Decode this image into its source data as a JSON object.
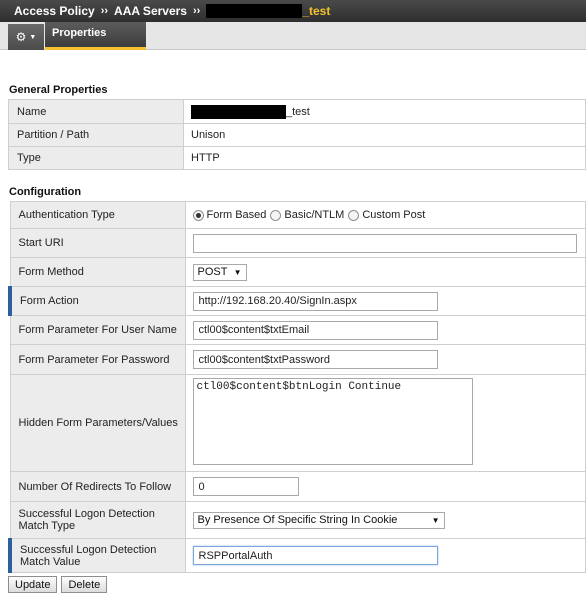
{
  "breadcrumb": {
    "items": [
      "Access Policy",
      "AAA Servers"
    ],
    "separator": "››",
    "last_suffix": "_test"
  },
  "toolbar": {
    "gear_icon": "gear-icon",
    "tab_properties": "Properties"
  },
  "general": {
    "title": "General Properties",
    "name_label": "Name",
    "name_suffix": "_test",
    "partition_label": "Partition / Path",
    "partition_value": "Unison",
    "type_label": "Type",
    "type_value": "HTTP"
  },
  "config": {
    "title": "Configuration",
    "auth_type_label": "Authentication Type",
    "auth_options": [
      "Form Based",
      "Basic/NTLM",
      "Custom Post"
    ],
    "auth_selected": "Form Based",
    "start_uri_label": "Start URI",
    "start_uri_value": "",
    "form_method_label": "Form Method",
    "form_method_value": "POST",
    "form_action_label": "Form Action",
    "form_action_value": "http://192.168.20.40/SignIn.aspx",
    "user_param_label": "Form Parameter For User Name",
    "user_param_value": "ctl00$content$txtEmail",
    "pass_param_label": "Form Parameter For Password",
    "pass_param_value": "ctl00$content$txtPassword",
    "hidden_label": "Hidden Form Parameters/Values",
    "hidden_value": "ctl00$content$btnLogin Continue",
    "redirects_label": "Number Of Redirects To Follow",
    "redirects_value": "0",
    "detect_type_label": "Successful Logon Detection Match Type",
    "detect_type_value": "By Presence Of Specific String In Cookie",
    "detect_value_label": "Successful Logon Detection Match Value",
    "detect_value_value": "RSPPortalAuth"
  },
  "buttons": {
    "update": "Update",
    "delete": "Delete"
  },
  "colors": {
    "accent": "#f5c12e",
    "required_marker": "#2c5fa0"
  }
}
